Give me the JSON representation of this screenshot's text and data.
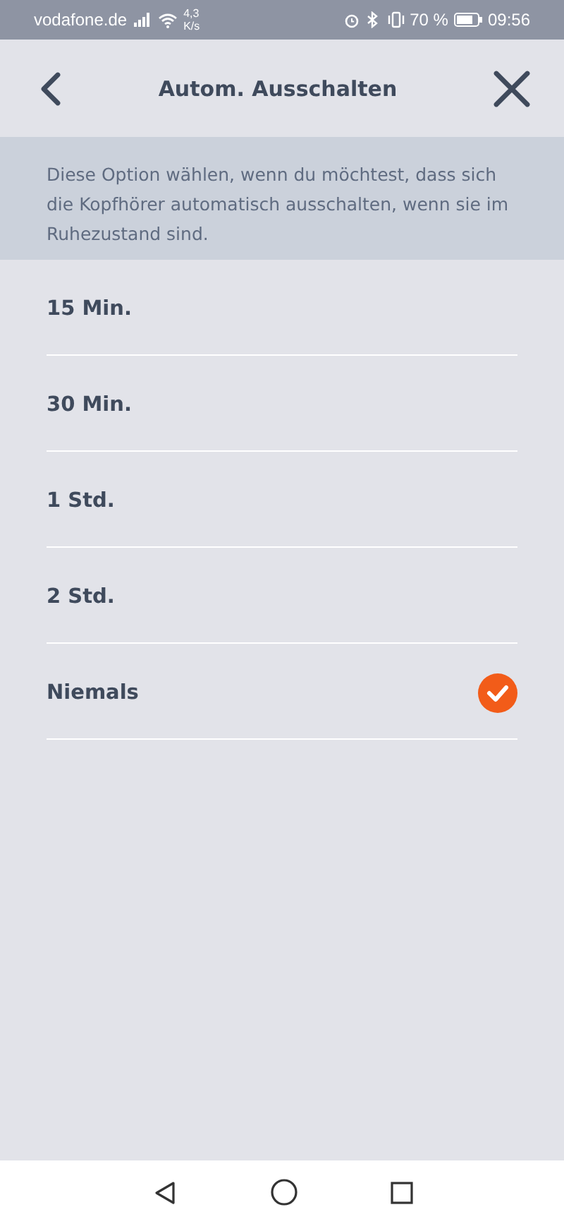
{
  "status_bar": {
    "carrier": "vodafone.de",
    "speed": "4,3 K/s",
    "battery": "70 %",
    "time": "09:56"
  },
  "header": {
    "title": "Autom. Ausschalten"
  },
  "info": "Diese Option wählen, wenn du möchtest, dass sich die Kopfhörer automatisch ausschalten, wenn sie im Ruhezustand sind.",
  "options": [
    {
      "label": "15 Min.",
      "selected": false
    },
    {
      "label": "30 Min.",
      "selected": false
    },
    {
      "label": "1 Std.",
      "selected": false
    },
    {
      "label": "2 Std.",
      "selected": false
    },
    {
      "label": "Niemals",
      "selected": true
    }
  ]
}
